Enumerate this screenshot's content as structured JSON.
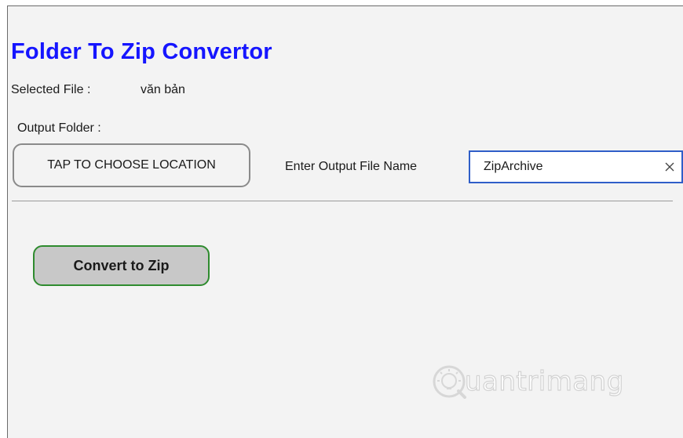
{
  "app": {
    "title": "Folder To Zip Convertor"
  },
  "selected_file": {
    "label": "Selected File :",
    "value": "văn bản"
  },
  "output_folder": {
    "label": "Output Folder :",
    "choose_button_label": "TAP TO CHOOSE LOCATION"
  },
  "output_file_name": {
    "label": "Enter Output File Name",
    "value": "ZipArchive"
  },
  "actions": {
    "convert_label": "Convert to Zip"
  },
  "watermark": {
    "text": "uantrimang"
  },
  "colors": {
    "title": "#1515ff",
    "input_border": "#2f5ec8",
    "convert_border": "#2e8b2e",
    "convert_fill": "#c8c8c8"
  }
}
